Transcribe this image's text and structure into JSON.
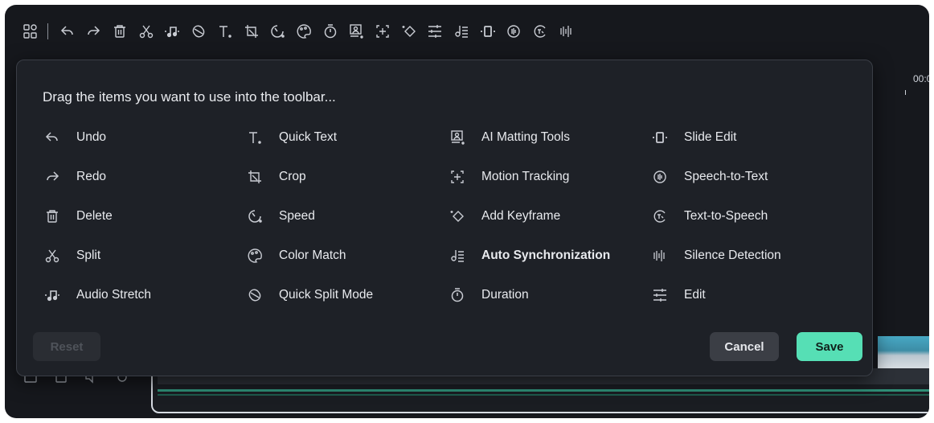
{
  "toolbar": {
    "icons": [
      "apps-icon",
      "undo-icon",
      "redo-icon",
      "delete-icon",
      "split-icon",
      "audio-stretch-icon",
      "quick-split-icon",
      "text-icon",
      "crop-icon",
      "speed-icon",
      "color-match-icon",
      "duration-icon",
      "ai-matting-icon",
      "motion-tracking-icon",
      "keyframe-icon",
      "edit-icon",
      "auto-sync-icon",
      "slide-edit-icon",
      "speech-to-text-icon",
      "text-to-speech-icon",
      "silence-detection-icon"
    ]
  },
  "timeline": {
    "time_label": "00:0"
  },
  "dialog": {
    "title": "Drag the items you want to use into the toolbar...",
    "columns": [
      [
        {
          "label": "Undo",
          "icon": "undo-icon"
        },
        {
          "label": "Redo",
          "icon": "redo-icon"
        },
        {
          "label": "Delete",
          "icon": "delete-icon"
        },
        {
          "label": "Split",
          "icon": "split-icon"
        },
        {
          "label": "Audio Stretch",
          "icon": "audio-stretch-icon"
        }
      ],
      [
        {
          "label": "Quick Text",
          "icon": "text-icon"
        },
        {
          "label": "Crop",
          "icon": "crop-icon"
        },
        {
          "label": "Speed",
          "icon": "speed-icon"
        },
        {
          "label": "Color Match",
          "icon": "color-match-icon"
        },
        {
          "label": "Quick Split Mode",
          "icon": "quick-split-icon"
        }
      ],
      [
        {
          "label": "AI Matting Tools",
          "icon": "ai-matting-icon"
        },
        {
          "label": "Motion Tracking",
          "icon": "motion-tracking-icon"
        },
        {
          "label": "Add Keyframe",
          "icon": "keyframe-icon"
        },
        {
          "label": "Auto Synchronization",
          "icon": "auto-sync-icon"
        },
        {
          "label": "Duration",
          "icon": "duration-icon"
        }
      ],
      [
        {
          "label": "Slide Edit",
          "icon": "slide-edit-icon"
        },
        {
          "label": "Speech-to-Text",
          "icon": "speech-to-text-icon"
        },
        {
          "label": "Text-to-Speech",
          "icon": "text-to-speech-icon"
        },
        {
          "label": "Silence Detection",
          "icon": "silence-detection-icon"
        },
        {
          "label": "Edit",
          "icon": "edit-icon"
        }
      ]
    ],
    "buttons": {
      "reset": "Reset",
      "cancel": "Cancel",
      "save": "Save"
    }
  },
  "colors": {
    "accent": "#56dfb5",
    "background": "#16181d",
    "dialog": "#1e2127"
  }
}
